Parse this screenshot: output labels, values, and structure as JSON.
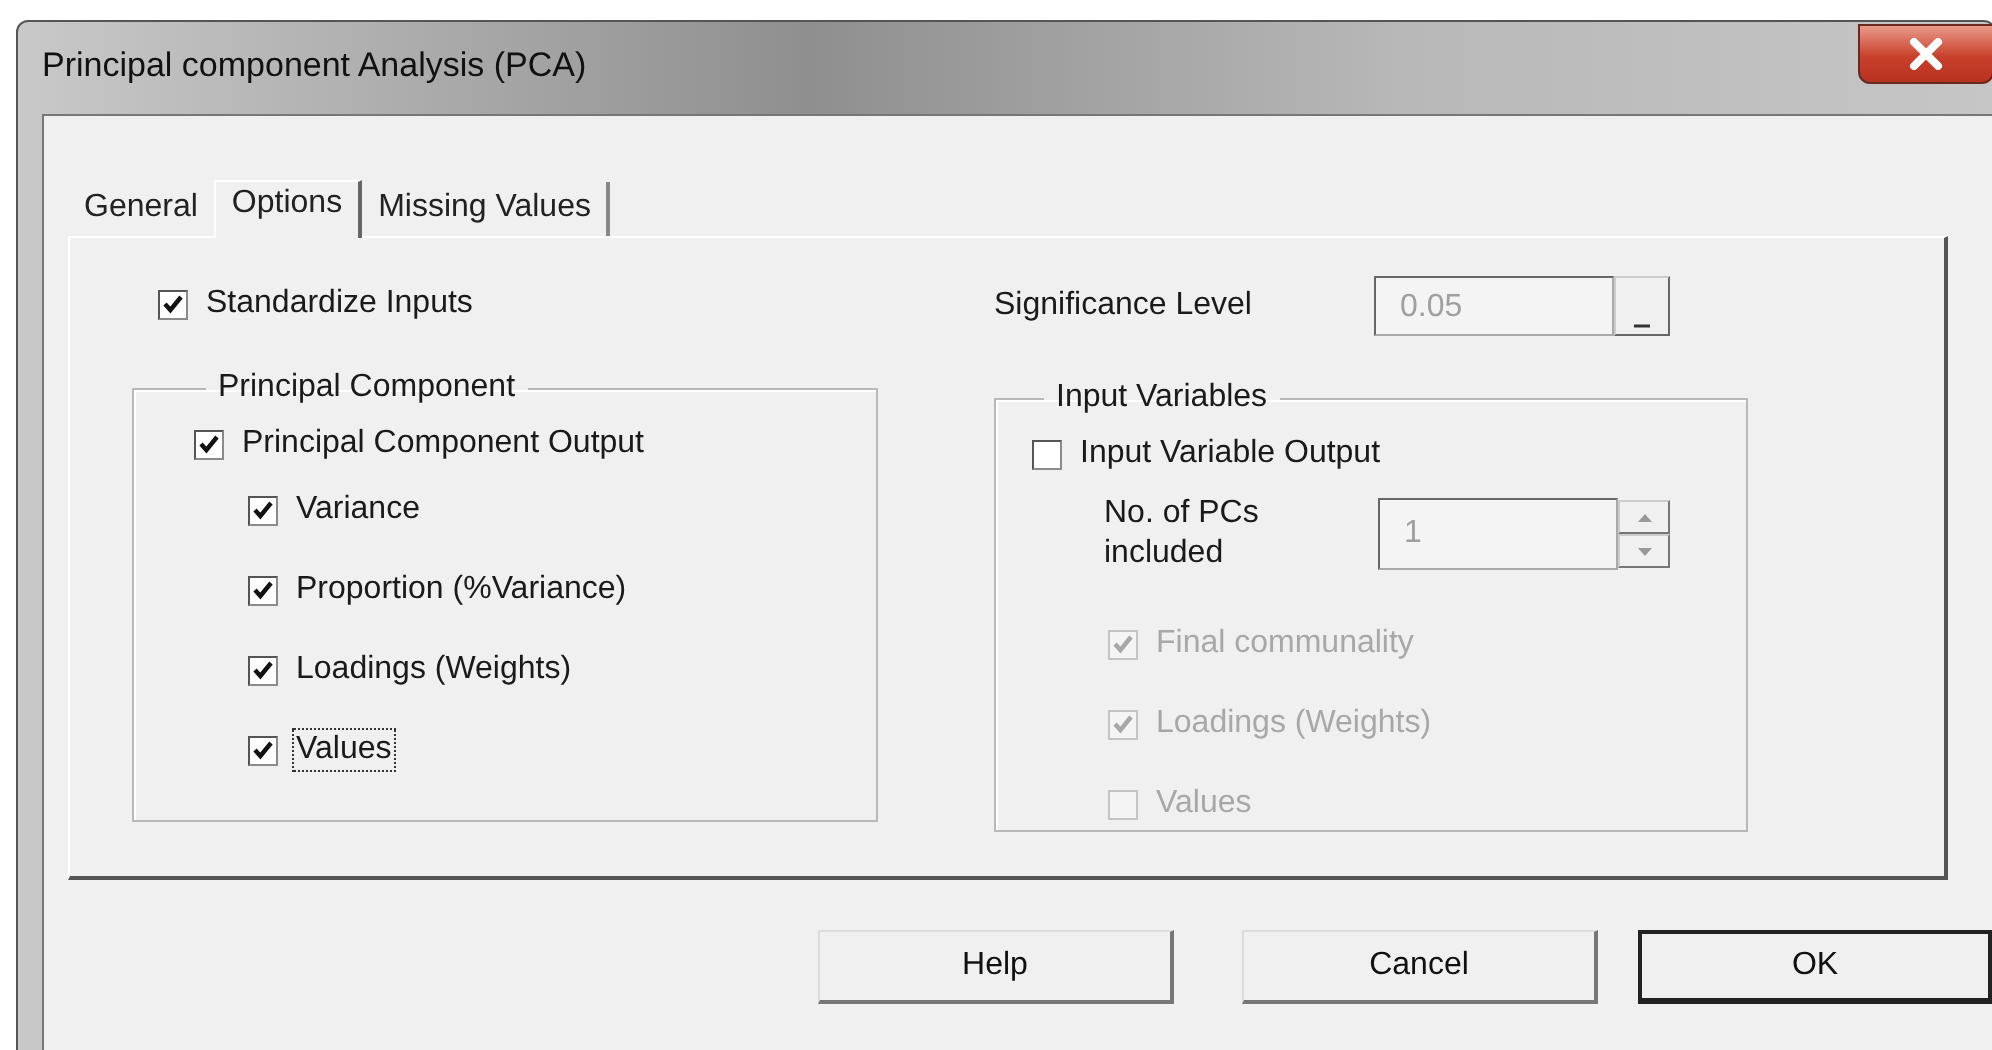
{
  "window": {
    "title": "Principal component Analysis (PCA)"
  },
  "tabs": [
    {
      "label": "General",
      "selected": false
    },
    {
      "label": "Options",
      "selected": true
    },
    {
      "label": "Missing Values",
      "selected": false
    }
  ],
  "standardize": {
    "label": "Standardize Inputs",
    "checked": true
  },
  "significance": {
    "label": "Significance Level",
    "value": "0.05",
    "disabled": true
  },
  "principal_component": {
    "title": "Principal Component",
    "output": {
      "label": "Principal Component Output",
      "checked": true
    },
    "items": [
      {
        "label": "Variance",
        "checked": true,
        "focused": false
      },
      {
        "label": "Proportion (%Variance)",
        "checked": true,
        "focused": false
      },
      {
        "label": "Loadings (Weights)",
        "checked": true,
        "focused": false
      },
      {
        "label": "Values",
        "checked": true,
        "focused": true
      }
    ]
  },
  "input_variables": {
    "title": "Input Variables",
    "output": {
      "label": "Input Variable Output",
      "checked": false
    },
    "pcs": {
      "label": "No. of PCs included",
      "value": "1",
      "disabled": true
    },
    "items": [
      {
        "label": "Final communality",
        "checked": true,
        "disabled": true
      },
      {
        "label": "Loadings (Weights)",
        "checked": true,
        "disabled": true
      },
      {
        "label": "Values",
        "checked": false,
        "disabled": true
      }
    ]
  },
  "buttons": [
    {
      "label": "Help",
      "kind": "normal"
    },
    {
      "label": "Cancel",
      "kind": "normal"
    },
    {
      "label": "OK",
      "kind": "default"
    }
  ]
}
